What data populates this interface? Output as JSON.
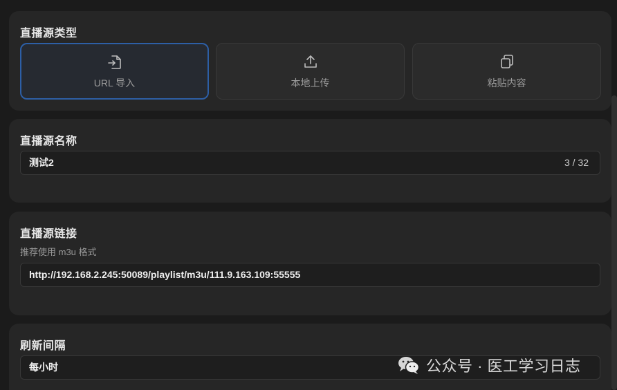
{
  "source_type": {
    "title": "直播源类型",
    "options": [
      {
        "label": "URL 导入",
        "icon": "file-import-icon",
        "selected": true
      },
      {
        "label": "本地上传",
        "icon": "upload-icon",
        "selected": false
      },
      {
        "label": "粘贴内容",
        "icon": "copy-icon",
        "selected": false
      }
    ]
  },
  "source_name": {
    "title": "直播源名称",
    "value": "测试2",
    "counter": "3 / 32"
  },
  "source_link": {
    "title": "直播源链接",
    "hint": "推荐使用 m3u 格式",
    "value": "http://192.168.2.245:50089/playlist/m3u/111.9.163.109:55555"
  },
  "refresh": {
    "title": "刷新间隔",
    "value": "每小时"
  },
  "watermark": {
    "text": "公众号 · 医工学习日志",
    "icon": "wechat-icon"
  },
  "colors": {
    "accent": "#2d5fa6",
    "background": "#1b1b1b",
    "card": "#262626"
  }
}
